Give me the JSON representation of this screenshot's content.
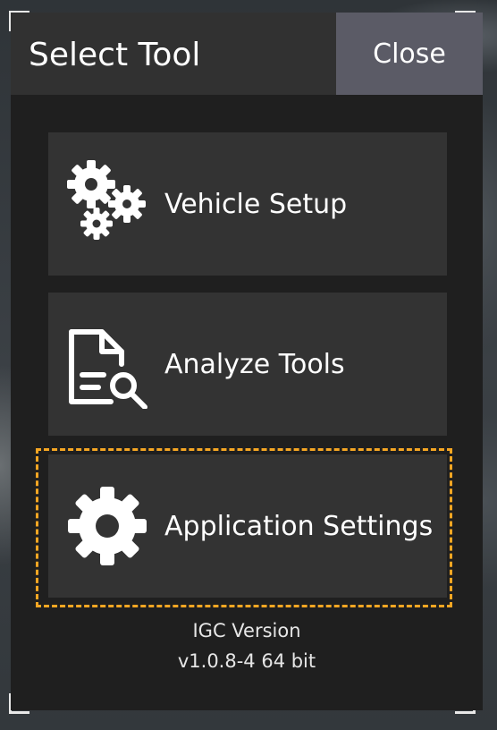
{
  "dialog": {
    "title": "Select Tool",
    "close_label": "Close"
  },
  "tools": [
    {
      "label": "Vehicle Setup",
      "icon": "gears-icon"
    },
    {
      "label": "Analyze Tools",
      "icon": "document-search-icon"
    },
    {
      "label": "Application Settings",
      "icon": "gear-icon",
      "highlighted": true
    }
  ],
  "version": {
    "line1": "IGC Version",
    "line2": "v1.0.8-4 64 bit"
  },
  "colors": {
    "highlight": "#f5a623",
    "close_button": "#5b5b66",
    "panel": "#1f1f1f",
    "tile": "#333333"
  }
}
